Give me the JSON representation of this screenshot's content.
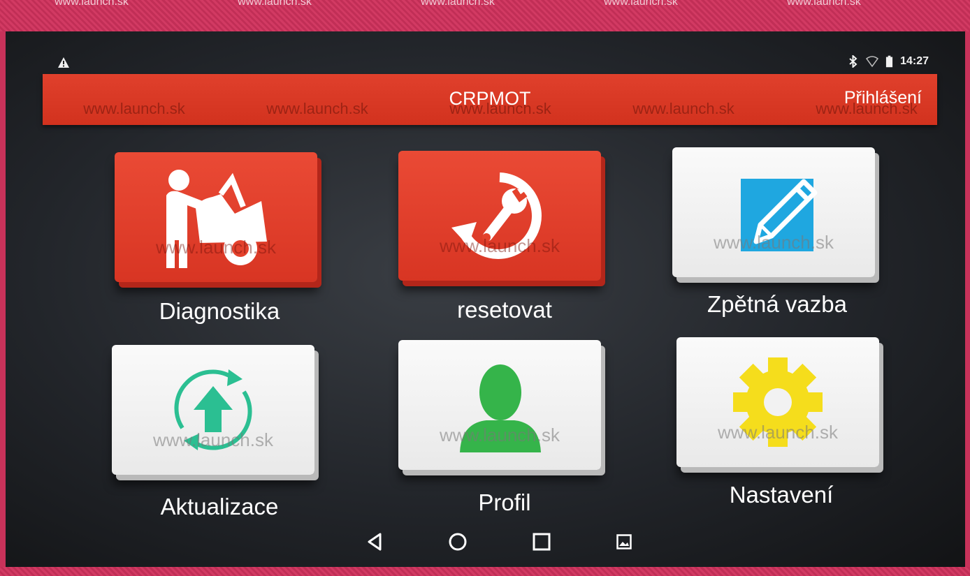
{
  "watermark": "www.launch.sk",
  "status": {
    "time": "14:27",
    "icons": [
      "warning-icon",
      "bluetooth-icon",
      "wifi-icon",
      "battery-icon"
    ]
  },
  "appbar": {
    "title": "CRPMOT",
    "login": "Přihlášení"
  },
  "tiles": [
    {
      "label": "Diagnostika",
      "icon": "mechanic-car-icon",
      "style": "red"
    },
    {
      "label": "resetovat",
      "icon": "wrench-reset-icon",
      "style": "red"
    },
    {
      "label": "Zpětná vazba",
      "icon": "pencil-edit-icon",
      "style": "white"
    },
    {
      "label": "Aktualizace",
      "icon": "update-arrow-icon",
      "style": "white"
    },
    {
      "label": "Profil",
      "icon": "person-icon",
      "style": "white"
    },
    {
      "label": "Nastavení",
      "icon": "gear-icon",
      "style": "white"
    }
  ],
  "navbar": {
    "icons": [
      "back-icon",
      "home-icon",
      "recents-icon",
      "screenshot-icon"
    ]
  },
  "colors": {
    "appbar": "#d9381f",
    "accent_red": "#e4412c",
    "update_teal": "#2bbf92",
    "profile_green": "#35b44a",
    "settings_yellow": "#f5dd1c",
    "feedback_blue": "#1fa7e0"
  }
}
